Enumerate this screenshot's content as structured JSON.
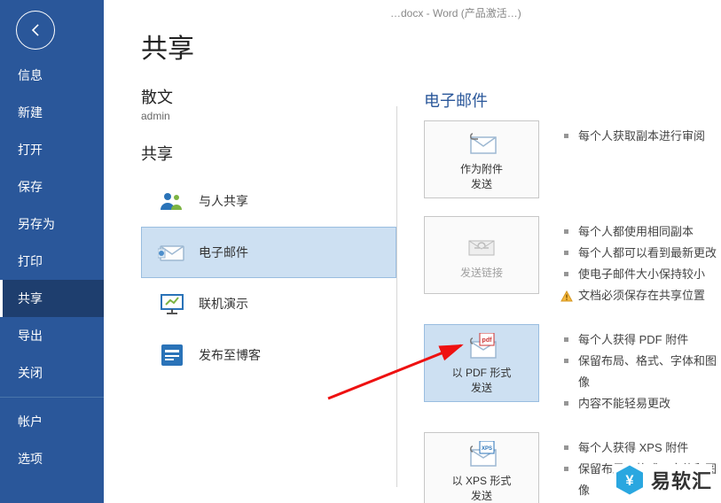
{
  "window_title": "…docx - Word (产品激活…)",
  "nav": {
    "items": [
      "信息",
      "新建",
      "打开",
      "保存",
      "另存为",
      "打印",
      "共享",
      "导出",
      "关闭"
    ],
    "active_index": 6,
    "footer_items": [
      "帐户",
      "选项"
    ]
  },
  "page": {
    "title": "共享",
    "doc_title": "散文",
    "doc_author": "admin",
    "section_title": "共享"
  },
  "share": {
    "items": [
      {
        "label": "与人共享",
        "icon": "people-icon"
      },
      {
        "label": "电子邮件",
        "icon": "envelope-icon"
      },
      {
        "label": "联机演示",
        "icon": "present-icon"
      },
      {
        "label": "发布至博客",
        "icon": "blog-icon"
      }
    ],
    "selected_index": 1
  },
  "email": {
    "heading": "电子邮件",
    "options": [
      {
        "label_line1": "作为附件",
        "label_line2": "发送",
        "icon": "attach-icon",
        "bullets": [
          "每个人获取副本进行审阅"
        ]
      },
      {
        "label_line1": "发送链接",
        "label_line2": "",
        "icon": "link-icon",
        "disabled": true,
        "bullets": [
          "每个人都使用相同副本",
          "每个人都可以看到最新更改",
          "使电子邮件大小保持较小"
        ],
        "warning": "文档必须保存在共享位置"
      },
      {
        "label_line1": "以 PDF 形式",
        "label_line2": "发送",
        "icon": "pdf-icon",
        "highlight": true,
        "bullets": [
          "每个人获得 PDF 附件",
          "保留布局、格式、字体和图像",
          "内容不能轻易更改"
        ]
      },
      {
        "label_line1": "以 XPS 形式",
        "label_line2": "发送",
        "icon": "xps-icon",
        "bullets": [
          "每个人获得 XPS 附件",
          "保留布局、格式、字体和图像"
        ]
      }
    ]
  },
  "watermark": {
    "text": "易软汇"
  }
}
